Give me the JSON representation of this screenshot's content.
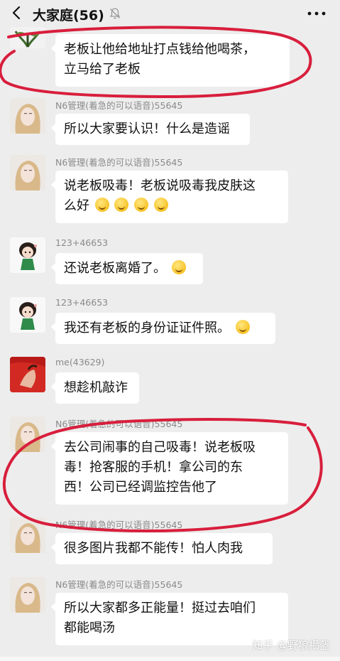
{
  "header": {
    "title": "大家庭(56)",
    "back_icon": "chevron-left-icon",
    "mute_icon": "bell-muted-icon",
    "more_icon": "more-dots-icon"
  },
  "messages": [
    {
      "sender": "",
      "lines": [
        "老板让他给地址打点钱给他喝茶，",
        "立马给了老板"
      ],
      "emoji_count": 0,
      "avatar": "flower"
    },
    {
      "sender": "N6管理(着急的可以语音)55645",
      "lines": [
        "所以大家要认识！什么是造谣"
      ],
      "emoji_count": 0,
      "avatar": "girl"
    },
    {
      "sender": "N6管理(着急的可以语音)55645",
      "lines": [
        "说老板吸毒！老板说吸毒我皮肤这",
        "么好"
      ],
      "emoji_count": 4,
      "avatar": "girl"
    },
    {
      "sender": "123+46653",
      "lines": [
        "还说老板离婚了。"
      ],
      "emoji_count": 1,
      "avatar": "cartoon"
    },
    {
      "sender": "123+46653",
      "lines": [
        "我还有老板的身份证证件照。"
      ],
      "emoji_count": 1,
      "avatar": "cartoon"
    },
    {
      "sender": "me(43629)",
      "lines": [
        "想趁机敲诈"
      ],
      "emoji_count": 0,
      "avatar": "red"
    },
    {
      "sender": "N6管理(着急的可以语音)55645",
      "lines": [
        "去公司闹事的自己吸毒！说老板吸",
        "毒！抢客服的手机！拿公司的东",
        "西！公司已经调监控告他了"
      ],
      "emoji_count": 0,
      "avatar": "girl"
    },
    {
      "sender": "N6管理(着急的可以语音)55645",
      "lines": [
        "很多图片我都不能传！怕人肉我"
      ],
      "emoji_count": 0,
      "avatar": "girl"
    },
    {
      "sender": "N6管理(着急的可以语音)55645",
      "lines": [
        "所以大家都多正能量！挺过去咱们",
        "都能喝汤"
      ],
      "emoji_count": 0,
      "avatar": "girl"
    }
  ],
  "annotation_color": "#d81e3c",
  "watermark": "知乎 @野狼揭盔"
}
